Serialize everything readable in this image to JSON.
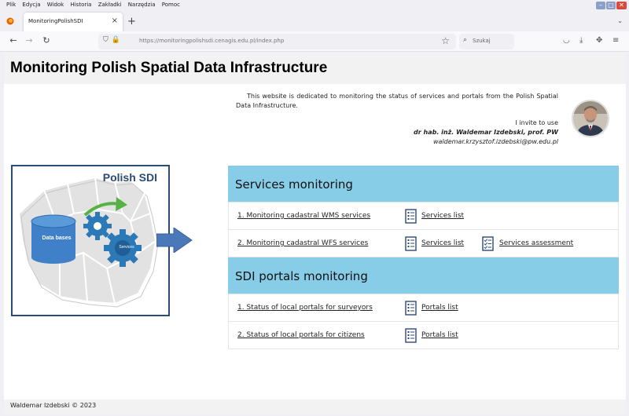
{
  "browser": {
    "menu": [
      "Plik",
      "Edycja",
      "Widok",
      "Historia",
      "Zakładki",
      "Narzędzia",
      "Pomoc"
    ],
    "tab_title": "MonitoringPolishSDI",
    "url": "https://monitoringpolishsdi.cenagis.edu.pl/index.php",
    "search_placeholder": "Szukaj"
  },
  "page": {
    "title": "Monitoring Polish Spatial Data Infrastructure",
    "intro": "This website is dedicated to monitoring the status of services and portals from the Polish Spatial Data Infrastructure.",
    "invite": "I invite to use",
    "author": "dr hab. inż. Waldemar Izdebski, prof. PW",
    "email": "waldemar.krzysztof.izdebski@pw.edu.pl",
    "figure": {
      "title": "Polish SDI",
      "db_label": "Data bases",
      "services_label": "Services"
    },
    "services_section": {
      "title": "Services monitoring",
      "rows": [
        {
          "label": "1. Monitoring cadastral WMS services",
          "list": "Services list"
        },
        {
          "label": "2. Monitoring cadastral WFS services",
          "list": "Services list",
          "assessment": "Services assessment"
        }
      ]
    },
    "portals_section": {
      "title": "SDI portals monitoring",
      "rows": [
        {
          "label": "1. Status of local portals for surveyors",
          "list": "Portals list"
        },
        {
          "label": "2. Status of local portals for citizens",
          "list": "Portals list"
        }
      ]
    },
    "footer": "Waldemar Izdebski © 2023"
  },
  "colors": {
    "section_header": "#87cde8",
    "figure_border": "#2d4a74",
    "arrow": "#4a78b8"
  }
}
